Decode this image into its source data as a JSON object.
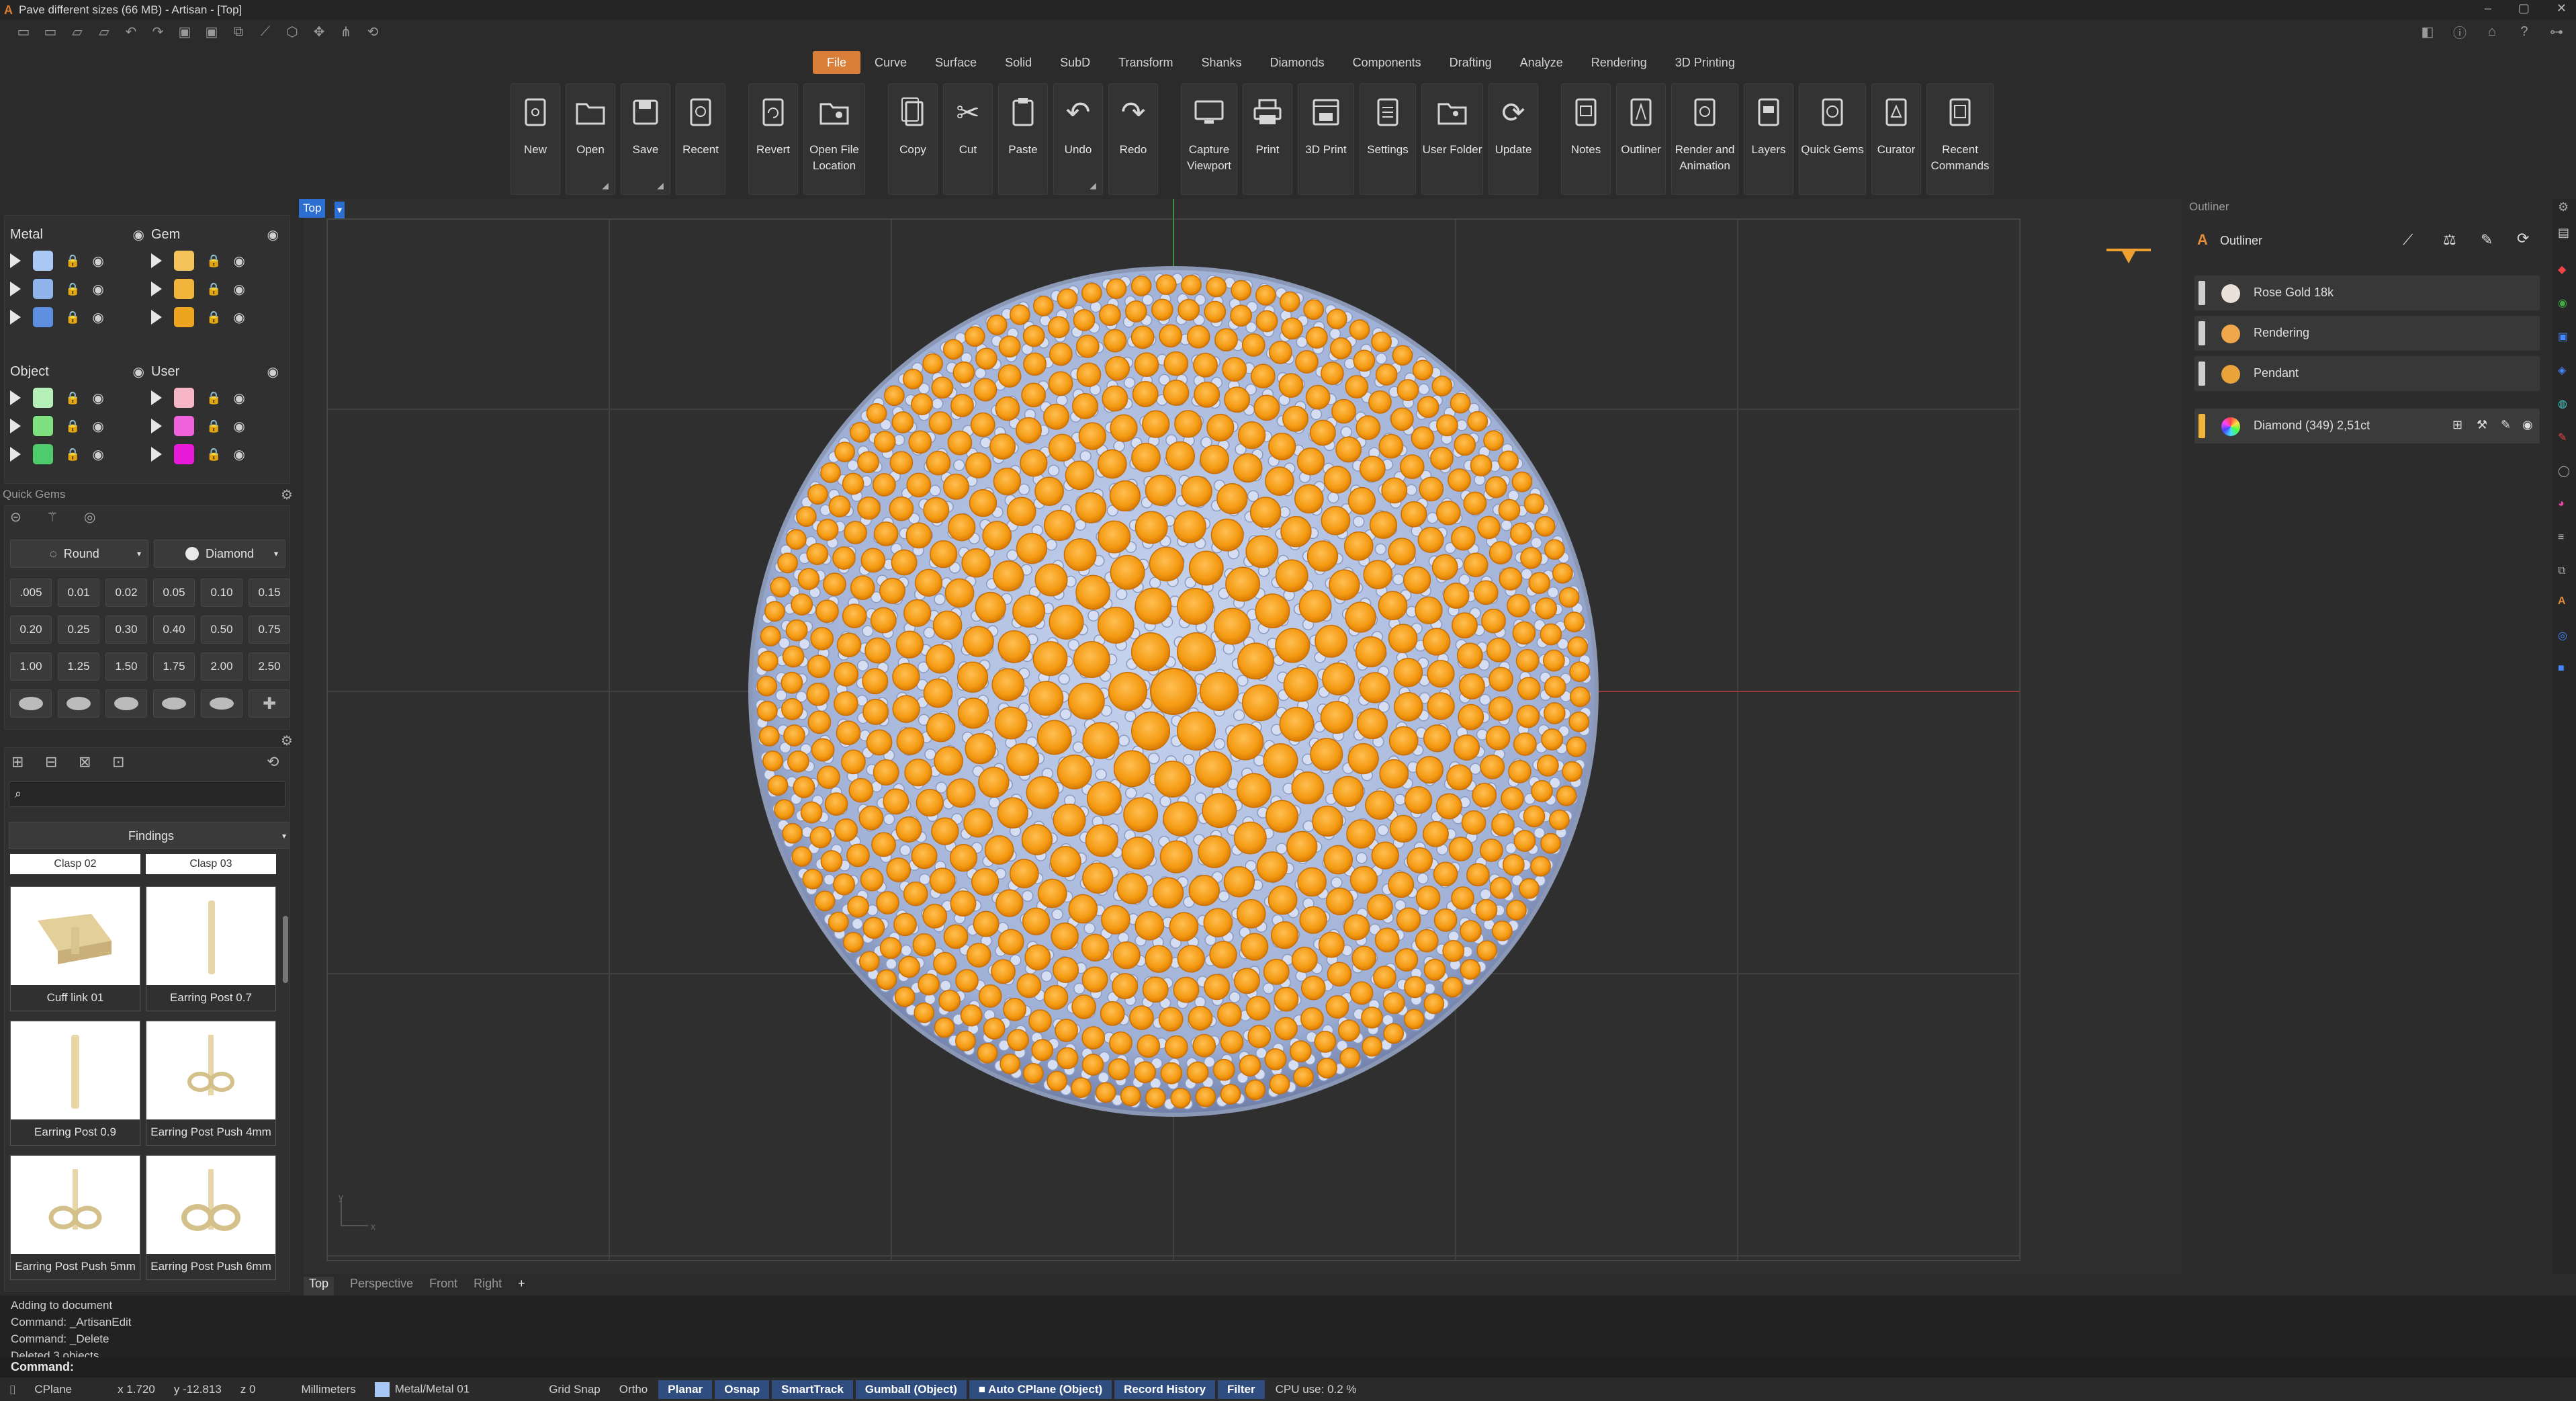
{
  "window": {
    "title": "Pave different sizes (66 MB) - Artisan - [Top]"
  },
  "menu_tabs": [
    "File",
    "Curve",
    "Surface",
    "Solid",
    "SubD",
    "Transform",
    "Shanks",
    "Diamonds",
    "Components",
    "Drafting",
    "Analyze",
    "Rendering",
    "3D Printing"
  ],
  "ribbon": [
    {
      "label": "New"
    },
    {
      "label": "Open"
    },
    {
      "label": "Save"
    },
    {
      "label": "Recent"
    },
    {
      "label": "Revert"
    },
    {
      "label": "Open File Location"
    },
    {
      "label": "Copy"
    },
    {
      "label": "Cut"
    },
    {
      "label": "Paste"
    },
    {
      "label": "Undo"
    },
    {
      "label": "Redo"
    },
    {
      "label": "Capture Viewport"
    },
    {
      "label": "Print"
    },
    {
      "label": "3D Print"
    },
    {
      "label": "Settings"
    },
    {
      "label": "User Folder"
    },
    {
      "label": "Update"
    },
    {
      "label": "Notes"
    },
    {
      "label": "Outliner"
    },
    {
      "label": "Render and Animation"
    },
    {
      "label": "Layers"
    },
    {
      "label": "Quick Gems"
    },
    {
      "label": "Curator"
    },
    {
      "label": "Recent Commands"
    }
  ],
  "layers": {
    "metal": {
      "title": "Metal",
      "colors": [
        "#a9c8f5",
        "#8fb4ec",
        "#5f8fe0"
      ]
    },
    "gem": {
      "title": "Gem",
      "colors": [
        "#f6c35a",
        "#f2b43a",
        "#eea41f"
      ]
    },
    "object": {
      "title": "Object",
      "colors": [
        "#b6f0b6",
        "#7fe07f",
        "#4ecb6b"
      ]
    },
    "user": {
      "title": "User",
      "colors": [
        "#f7b6c5",
        "#f062dc",
        "#e61ad8"
      ]
    }
  },
  "quick_gems": {
    "title": "Quick Gems",
    "shape": "Round",
    "material": "Diamond",
    "sizes": [
      ".005",
      "0.01",
      "0.02",
      "0.05",
      "0.10",
      "0.15",
      "0.20",
      "0.25",
      "0.30",
      "0.40",
      "0.50",
      "0.75",
      "1.00",
      "1.25",
      "1.50",
      "1.75",
      "2.00",
      "2.50"
    ]
  },
  "library": {
    "category": "Findings",
    "header_items": [
      "Clasp 02",
      "Clasp 03"
    ],
    "items": [
      "Cuff link 01",
      "Earring Post 0.7",
      "Earring Post 0.9",
      "Earring Post Push 4mm",
      "Earring Post Push 5mm",
      "Earring Post Push 6mm"
    ]
  },
  "viewport": {
    "name": "Top",
    "tabs": [
      "Top",
      "Perspective",
      "Front",
      "Right"
    ],
    "add": "+"
  },
  "outliner": {
    "title": "Outliner",
    "root": "Outliner",
    "items": [
      {
        "label": "Rose Gold 18k",
        "color": "#e9e0d8"
      },
      {
        "label": "Rendering",
        "color": "#f0a64a"
      },
      {
        "label": "Pendant",
        "color": "#e8a33b"
      }
    ],
    "selected": {
      "label": "Diamond (349) 2,51ct",
      "color": "#f2b43a"
    }
  },
  "command_history": [
    "Adding to document",
    "Command: _ArtisanEdit",
    "Command: _Delete",
    "Deleted 3 objects."
  ],
  "command_prompt": "Command:",
  "status": {
    "cplane": "CPlane",
    "x": "x 1.720",
    "y": "y -12.813",
    "z": "z 0",
    "units": "Millimeters",
    "layer": "Metal/Metal 01",
    "grid_snap": "Grid Snap",
    "ortho": "Ortho",
    "planar": "Planar",
    "osnap": "Osnap",
    "smarttrack": "SmartTrack",
    "gumball": "Gumball (Object)",
    "auto_cplane": "Auto CPlane (Object)",
    "record_history": "Record History",
    "filter": "Filter",
    "cpu": "CPU use: 0.2 %"
  }
}
